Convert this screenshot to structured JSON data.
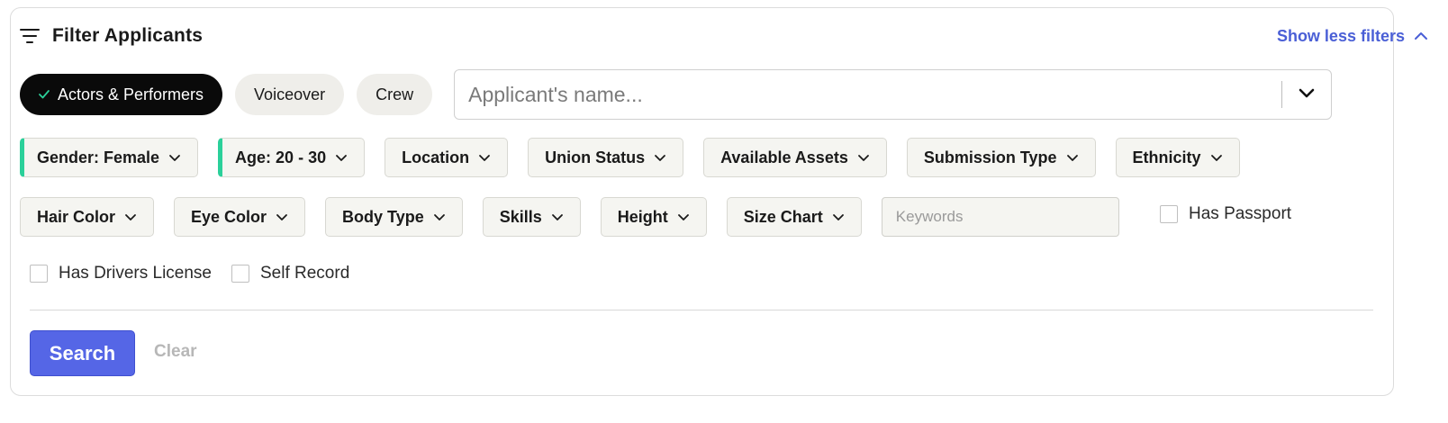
{
  "header": {
    "title": "Filter Applicants",
    "title_icon": "filter-lines-icon",
    "toggle_label": "Show less filters",
    "toggle_icon": "chevron-up-icon"
  },
  "categories": [
    {
      "label": "Actors & Performers",
      "selected": true
    },
    {
      "label": "Voiceover",
      "selected": false
    },
    {
      "label": "Crew",
      "selected": false
    }
  ],
  "name_search": {
    "placeholder": "Applicant's name...",
    "value": ""
  },
  "filters_row1": [
    {
      "label": "Gender: Female",
      "active": true
    },
    {
      "label": "Age: 20 - 30",
      "active": true
    },
    {
      "label": "Location",
      "active": false
    },
    {
      "label": "Union Status",
      "active": false
    },
    {
      "label": "Available Assets",
      "active": false
    },
    {
      "label": "Submission Type",
      "active": false
    },
    {
      "label": "Ethnicity",
      "active": false
    }
  ],
  "filters_row2": [
    {
      "label": "Hair Color"
    },
    {
      "label": "Eye Color"
    },
    {
      "label": "Body Type"
    },
    {
      "label": "Skills"
    },
    {
      "label": "Height"
    },
    {
      "label": "Size Chart"
    }
  ],
  "keywords": {
    "placeholder": "Keywords",
    "value": ""
  },
  "checkboxes": {
    "has_passport": {
      "label": "Has Passport",
      "checked": false
    },
    "has_drivers_license": {
      "label": "Has Drivers License",
      "checked": false
    },
    "self_record": {
      "label": "Self Record",
      "checked": false
    }
  },
  "actions": {
    "search_label": "Search",
    "clear_label": "Clear"
  },
  "colors": {
    "accent": "#5566e6",
    "link": "#4a5fd6",
    "active_filter_marker": "#2bd09a",
    "selected_pill": "#0a0a0a",
    "check_mark": "#2bd09a"
  }
}
